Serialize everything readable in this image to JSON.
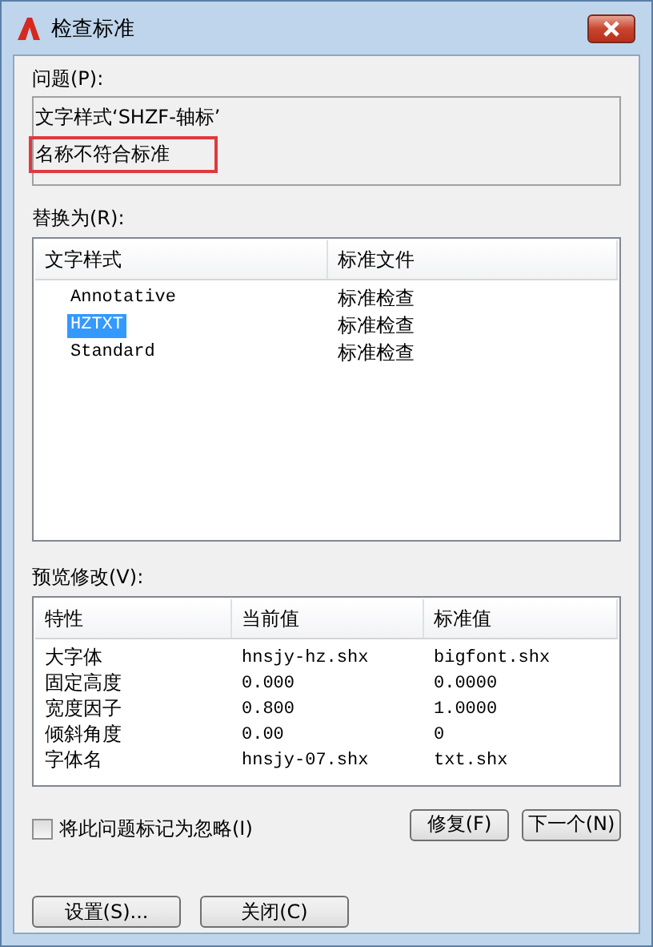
{
  "window": {
    "title": "检查标准"
  },
  "problem": {
    "label": "问题(P):",
    "lines": [
      {
        "text": "文字样式‘SHZF-轴标’",
        "highlighted": false
      },
      {
        "text": "名称不符合标准",
        "highlighted": true
      }
    ]
  },
  "replace": {
    "label": "替换为(R):",
    "columns": [
      "文字样式",
      "标准文件"
    ],
    "rows": [
      {
        "style": "Annotative",
        "file": "标准检查",
        "selected": false
      },
      {
        "style": "HZTXT",
        "file": "标准检查",
        "selected": true
      },
      {
        "style": "Standard",
        "file": "标准检查",
        "selected": false
      }
    ]
  },
  "preview": {
    "label": "预览修改(V):",
    "columns": [
      "特性",
      "当前值",
      "标准值"
    ],
    "rows": [
      [
        "大字体",
        "hnsjy-hz.shx",
        "bigfont.shx"
      ],
      [
        "固定高度",
        "0.000",
        "0.0000"
      ],
      [
        "宽度因子",
        "0.800",
        "1.0000"
      ],
      [
        "倾斜角度",
        "0.00",
        "0"
      ],
      [
        "字体名",
        "hnsjy-07.shx",
        "txt.shx"
      ]
    ]
  },
  "ignore": {
    "label": "将此问题标记为忽略(I)",
    "checked": false
  },
  "action_buttons": [
    "修复(F)",
    "下一个(N)"
  ],
  "footer_buttons": [
    "设置(S)...",
    "关闭(C)"
  ]
}
